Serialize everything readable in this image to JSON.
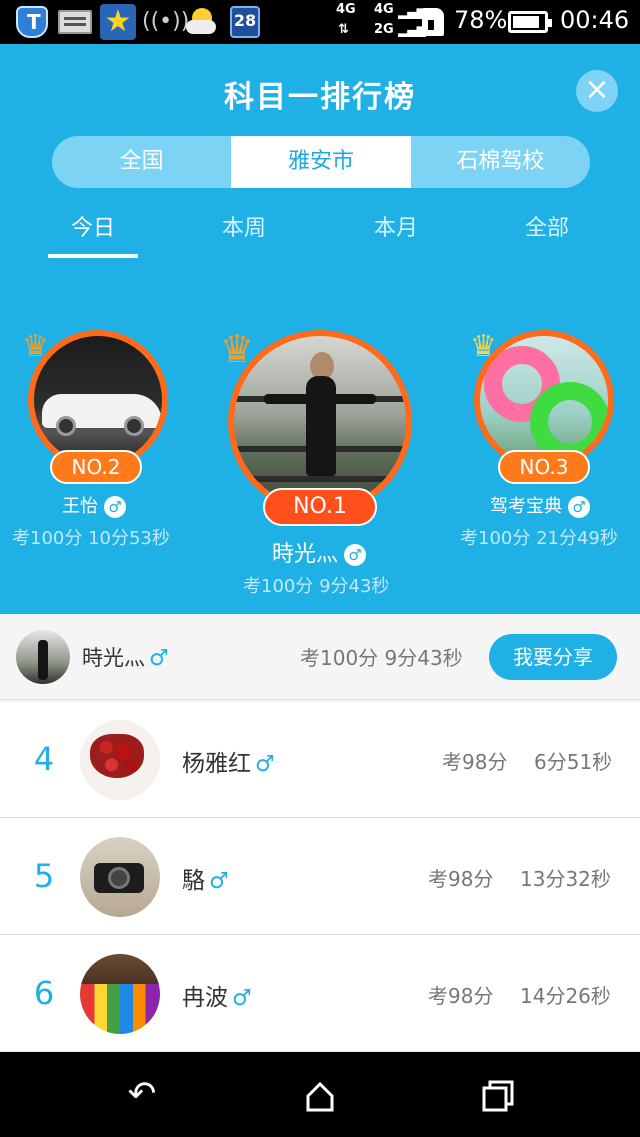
{
  "status_bar": {
    "network_a": "4G",
    "network_b": "4G",
    "network_c": "2G",
    "calendar_day": "28",
    "battery": "78%",
    "time": "00:46",
    "icons": [
      "shield-icon",
      "card-icon",
      "star-icon",
      "wifi-icon",
      "weather-icon",
      "calendar-icon",
      "sim-icon",
      "battery-icon"
    ]
  },
  "header": {
    "title": "科目一排行榜",
    "close_icon": "close-icon"
  },
  "scope_tabs": [
    {
      "label": "全国",
      "active": false
    },
    {
      "label": "雅安市",
      "active": true
    },
    {
      "label": "石棉驾校",
      "active": false
    }
  ],
  "range_tabs": [
    {
      "label": "今日",
      "active": true
    },
    {
      "label": "本周",
      "active": false
    },
    {
      "label": "本月",
      "active": false
    },
    {
      "label": "全部",
      "active": false
    }
  ],
  "podium": {
    "first": {
      "badge": "NO.1",
      "name": "時光灬",
      "gender": "♂",
      "score": "考100分 9分43秒"
    },
    "second": {
      "badge": "NO.2",
      "name": "王怡",
      "gender": "♂",
      "score": "考100分 10分53秒"
    },
    "third": {
      "badge": "NO.3",
      "name": "驾考宝典",
      "gender": "♂",
      "score": "考100分 21分49秒"
    }
  },
  "my_rank": {
    "name": "時光灬",
    "gender": "♂",
    "score": "考100分 9分43秒",
    "share_label": "我要分享"
  },
  "list": [
    {
      "rank": "4",
      "name": "杨雅红",
      "gender": "♂",
      "score": "考98分",
      "time": "6分51秒"
    },
    {
      "rank": "5",
      "name": "駱",
      "gender": "♂",
      "score": "考98分",
      "time": "13分32秒"
    },
    {
      "rank": "6",
      "name": "冉波",
      "gender": "♂",
      "score": "考98分",
      "time": "14分26秒"
    }
  ],
  "colors": {
    "primary": "#1fb0e6",
    "badge_orange": "#ff7a1a",
    "badge_red": "#ff4f1a"
  }
}
